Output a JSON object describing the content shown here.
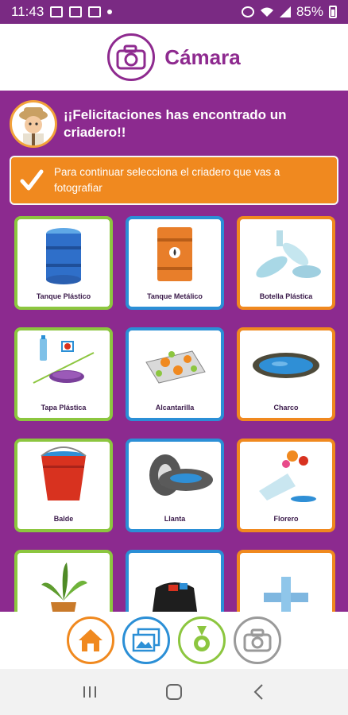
{
  "status_bar": {
    "time": "11:43",
    "battery": "85%"
  },
  "header": {
    "title": "Cámara"
  },
  "banner": {
    "text": "¡¡Felicitaciones has encontrado un criadero!!"
  },
  "instruction": {
    "text": "Para continuar selecciona el criadero que vas a fotografiar"
  },
  "cards": [
    {
      "label": "Tanque Plástico",
      "border": "green"
    },
    {
      "label": "Tanque Metálico",
      "border": "blue"
    },
    {
      "label": "Botella Plástica",
      "border": "orange"
    },
    {
      "label": "Tapa Plástica",
      "border": "green"
    },
    {
      "label": "Alcantarilla",
      "border": "blue"
    },
    {
      "label": "Charco",
      "border": "orange"
    },
    {
      "label": "Balde",
      "border": "green"
    },
    {
      "label": "Llanta",
      "border": "blue"
    },
    {
      "label": "Florero",
      "border": "orange"
    },
    {
      "label": "",
      "border": "green"
    },
    {
      "label": "",
      "border": "blue"
    },
    {
      "label": "",
      "border": "orange"
    }
  ],
  "colors": {
    "purple": "#8c2a8f",
    "orange": "#f0891f",
    "blue": "#2b8fd6",
    "green": "#8cc63f",
    "gray": "#9a9a9a"
  }
}
